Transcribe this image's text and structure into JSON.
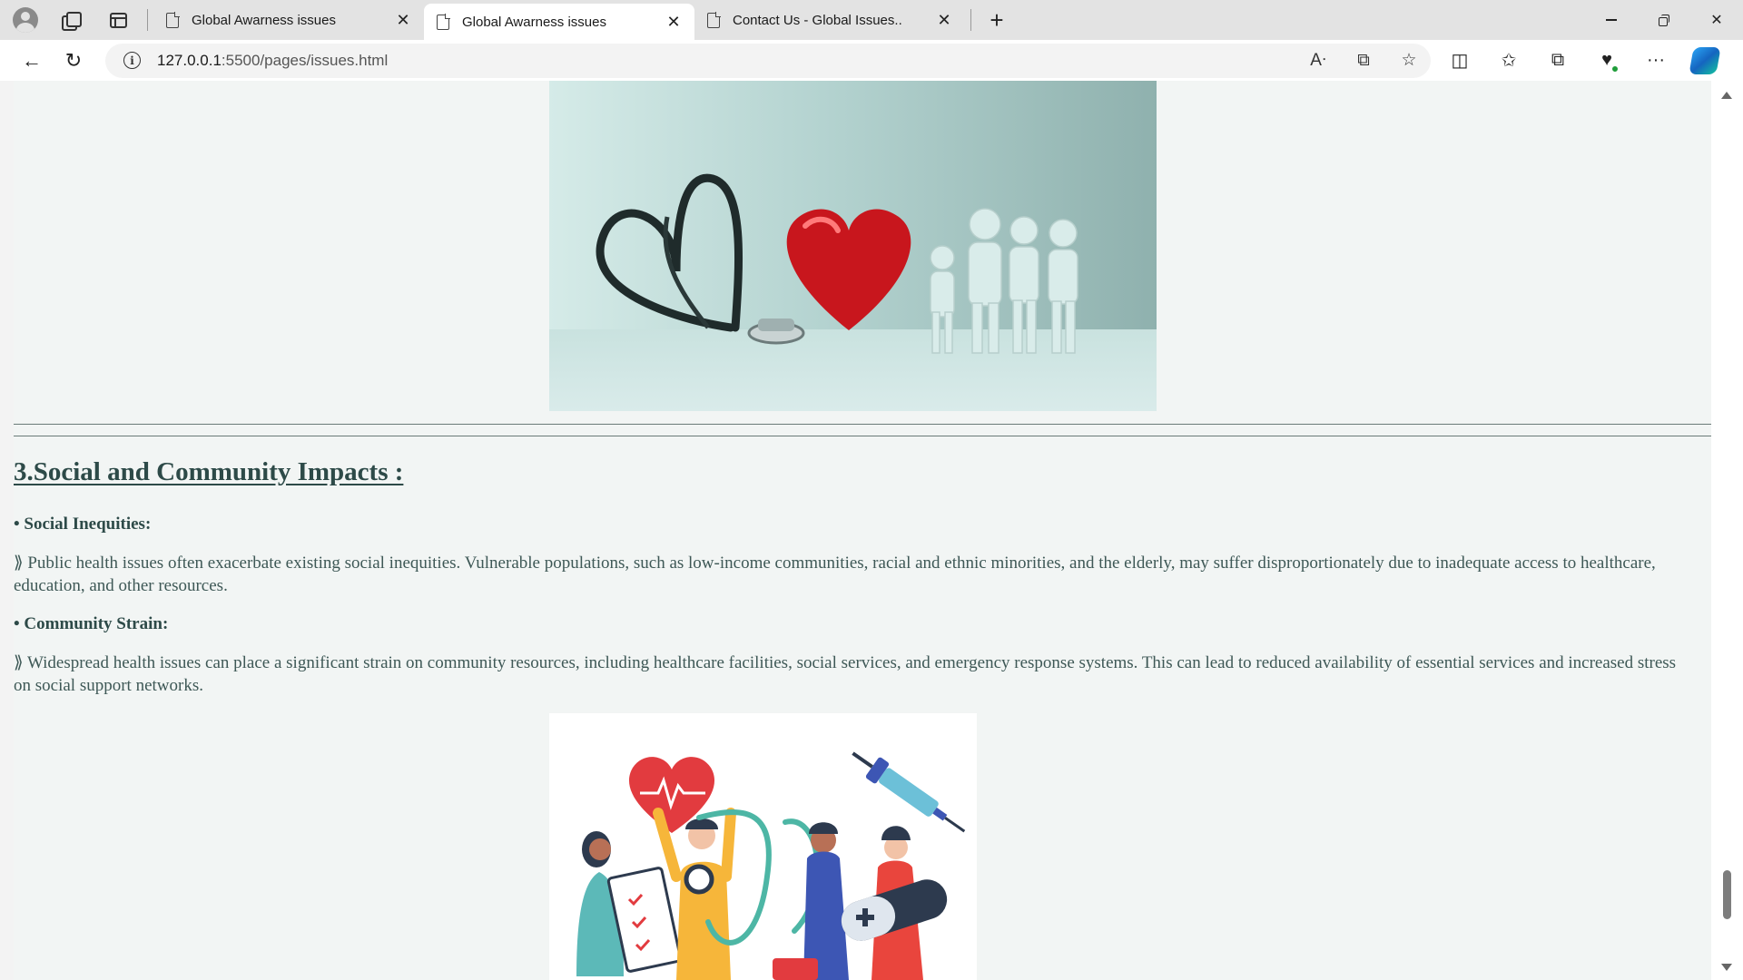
{
  "browser": {
    "tabs": [
      {
        "title": "Global Awarness issues",
        "active": false
      },
      {
        "title": "Global Awarness issues",
        "active": true
      },
      {
        "title": "Contact Us - Global Issues..",
        "active": false
      }
    ],
    "new_tab_label": "+",
    "close_label": "✕",
    "window": {
      "minimize": "–",
      "maximize": "□",
      "close": "✕"
    },
    "address": {
      "host": "127.0.0.1",
      "path": ":5500/pages/issues.html"
    },
    "icons": {
      "back": "back-arrow-icon",
      "reload": "reload-icon",
      "info": "info-icon",
      "read_aloud": "read-aloud-icon",
      "immersive_reader": "immersive-reader-icon",
      "favorite": "star-icon",
      "split_screen": "split-screen-icon",
      "favorites": "favorites-icon",
      "collections": "collections-icon",
      "extension": "extension-icon",
      "more": "more-icon",
      "copilot": "copilot-icon"
    },
    "glyphs": {
      "back": "←",
      "reload": "↻",
      "info": "i",
      "read_aloud": "Aᐧ",
      "immersive_reader": "⧉",
      "favorite": "☆",
      "split_screen": "◫",
      "favorites": "✩",
      "collections": "⧉",
      "extension": "♥",
      "more": "···"
    }
  },
  "content": {
    "section_heading": "3.Social and Community Impacts :",
    "items": [
      {
        "heading": "• Social Inequities:",
        "text": "⟫ Public health issues often exacerbate existing social inequities. Vulnerable populations, such as low-income communities, racial and ethnic minorities, and the elderly, may suffer disproportionately due to inadequate access to healthcare, education, and other resources."
      },
      {
        "heading": "• Community Strain:",
        "text": "⟫ Widespread health issues can place a significant strain on community resources, including healthcare facilities, social services, and emergency response systems. This can lead to reduced availability of essential services and increased stress on social support networks."
      }
    ]
  },
  "colors": {
    "heading": "#2d4a48",
    "body_text": "#3e5856",
    "page_bg": "#f2f5f4"
  }
}
